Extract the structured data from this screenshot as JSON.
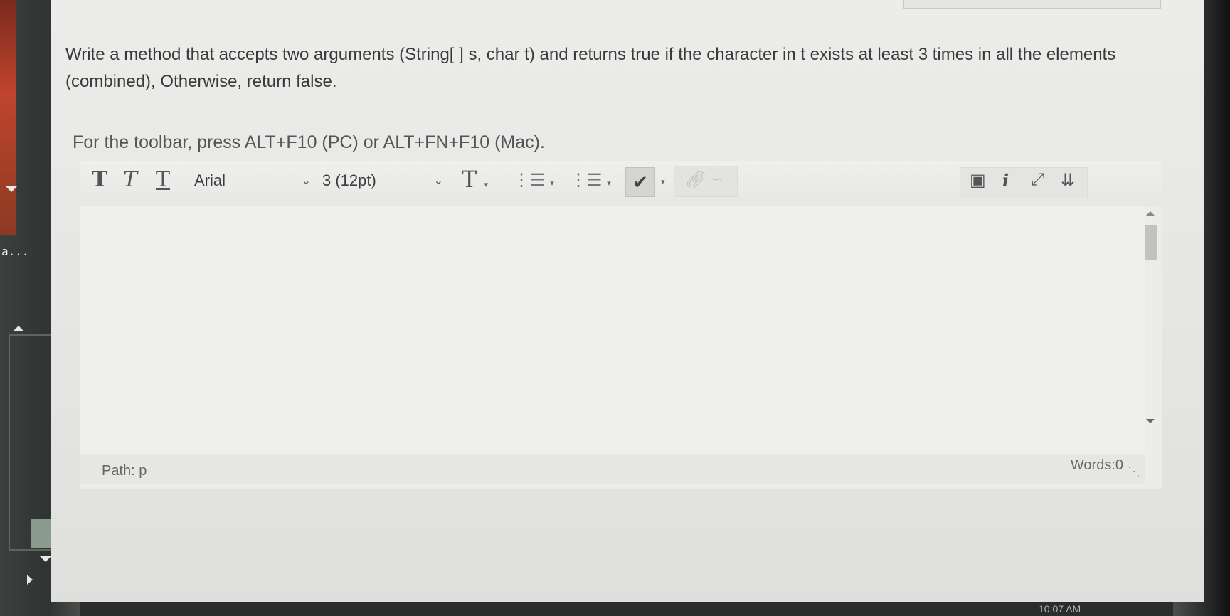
{
  "question": {
    "text": "Write a method that accepts two arguments (String[ ] s, char t) and returns true if the character in t exists at least 3 times in all the elements (combined), Otherwise, return false."
  },
  "hint": "For the toolbar, press ALT+F10 (PC) or ALT+FN+F10 (Mac).",
  "toolbar": {
    "bold": "T",
    "italic": "T",
    "underline": "T",
    "font": "Arial",
    "size": "3 (12pt)",
    "text_color": "T",
    "bullet_list": "⋮☰",
    "numbered_list": "⋮☰",
    "spell": "✔",
    "info": "i"
  },
  "status": {
    "path_label": "Path:",
    "path_value": "p",
    "words": "Words:0"
  },
  "left_strip": {
    "label": "a..."
  },
  "clock": "10:07 AM"
}
